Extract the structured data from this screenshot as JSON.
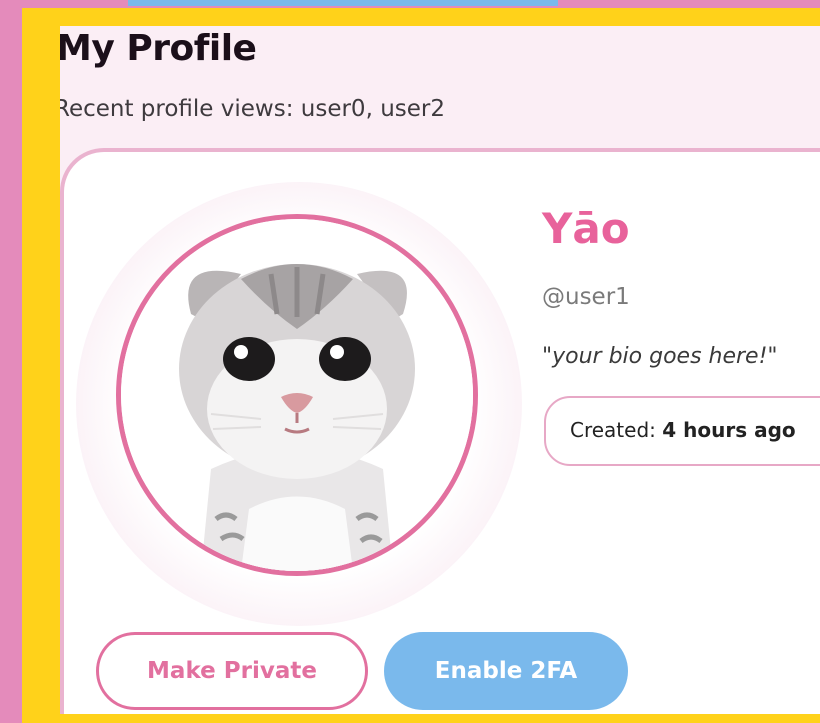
{
  "header": {
    "title": "My Profile",
    "recent_views_text": "Recent profile views: user0, user2"
  },
  "profile": {
    "display_name": "Yāo",
    "username": "@user1",
    "bio": "\"your bio goes here!\"",
    "created_label": "Created:",
    "created_value": "4 hours ago",
    "avatar_icon": "kitten-avatar-icon"
  },
  "actions": {
    "make_private_label": "Make Private",
    "enable_2fa_label": "Enable 2FA"
  },
  "colors": {
    "accent_pink": "#e8629b",
    "border_pink": "#e2709f",
    "button_blue": "#7ab9ec",
    "frame_yellow": "#ffd21a",
    "page_bg": "#fbeef5"
  }
}
